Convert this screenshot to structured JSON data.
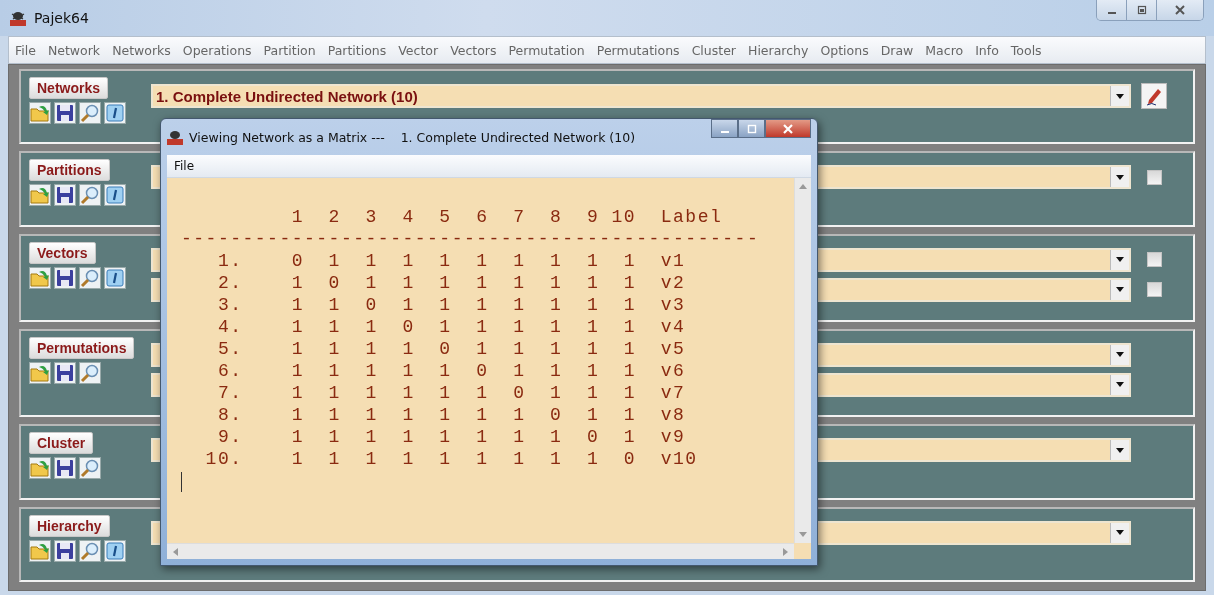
{
  "window": {
    "title": "Pajek64"
  },
  "menu": [
    "File",
    "Network",
    "Networks",
    "Operations",
    "Partition",
    "Partitions",
    "Vector",
    "Vectors",
    "Permutation",
    "Permutations",
    "Cluster",
    "Hierarchy",
    "Options",
    "Draw",
    "Macro",
    "Info",
    "Tools"
  ],
  "panels": [
    {
      "label": "Networks",
      "info_button": true,
      "combos": [
        {
          "kind": "pencil",
          "value": "1. Complete Undirected Network (10)"
        }
      ]
    },
    {
      "label": "Partitions",
      "info_button": true,
      "combos": [
        {
          "kind": "checkbox",
          "checked": false
        }
      ]
    },
    {
      "label": "Vectors",
      "info_button": true,
      "combos": [
        {
          "kind": "checkbox",
          "checked": false
        },
        {
          "kind": "checkbox",
          "checked": false
        }
      ]
    },
    {
      "label": "Permutations",
      "info_button": false,
      "combos": [
        {
          "kind": "plain"
        },
        {
          "kind": "plain"
        }
      ]
    },
    {
      "label": "Cluster",
      "info_button": false,
      "combos": [
        {
          "kind": "plain"
        }
      ]
    },
    {
      "label": "Hierarchy",
      "info_button": true,
      "combos": [
        {
          "kind": "plain"
        }
      ]
    }
  ],
  "viewer": {
    "title": "Viewing Network as a Matrix ---    1. Complete Undirected Network (10)",
    "menu": [
      "File"
    ],
    "matrix": {
      "columns": [
        "1",
        "2",
        "3",
        "4",
        "5",
        "6",
        "7",
        "8",
        "9",
        "10"
      ],
      "label_heading": "Label",
      "rule": "-----------------------------------------------",
      "rows": [
        {
          "index": "1.",
          "values": [
            "0",
            "1",
            "1",
            "1",
            "1",
            "1",
            "1",
            "1",
            "1",
            "1"
          ],
          "label": "v1"
        },
        {
          "index": "2.",
          "values": [
            "1",
            "0",
            "1",
            "1",
            "1",
            "1",
            "1",
            "1",
            "1",
            "1"
          ],
          "label": "v2"
        },
        {
          "index": "3.",
          "values": [
            "1",
            "1",
            "0",
            "1",
            "1",
            "1",
            "1",
            "1",
            "1",
            "1"
          ],
          "label": "v3"
        },
        {
          "index": "4.",
          "values": [
            "1",
            "1",
            "1",
            "0",
            "1",
            "1",
            "1",
            "1",
            "1",
            "1"
          ],
          "label": "v4"
        },
        {
          "index": "5.",
          "values": [
            "1",
            "1",
            "1",
            "1",
            "0",
            "1",
            "1",
            "1",
            "1",
            "1"
          ],
          "label": "v5"
        },
        {
          "index": "6.",
          "values": [
            "1",
            "1",
            "1",
            "1",
            "1",
            "0",
            "1",
            "1",
            "1",
            "1"
          ],
          "label": "v6"
        },
        {
          "index": "7.",
          "values": [
            "1",
            "1",
            "1",
            "1",
            "1",
            "1",
            "0",
            "1",
            "1",
            "1"
          ],
          "label": "v7"
        },
        {
          "index": "8.",
          "values": [
            "1",
            "1",
            "1",
            "1",
            "1",
            "1",
            "1",
            "0",
            "1",
            "1"
          ],
          "label": "v8"
        },
        {
          "index": "9.",
          "values": [
            "1",
            "1",
            "1",
            "1",
            "1",
            "1",
            "1",
            "1",
            "0",
            "1"
          ],
          "label": "v9"
        },
        {
          "index": "10.",
          "values": [
            "1",
            "1",
            "1",
            "1",
            "1",
            "1",
            "1",
            "1",
            "1",
            "0"
          ],
          "label": "v10"
        }
      ]
    }
  }
}
